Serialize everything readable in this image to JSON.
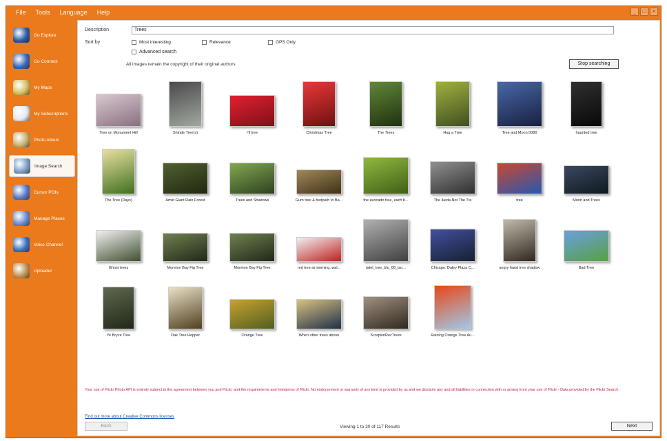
{
  "window": {
    "menu": [
      "File",
      "Tools",
      "Language",
      "Help"
    ],
    "buttons": [
      "_",
      "□",
      "×"
    ]
  },
  "sidebar": {
    "items": [
      {
        "label": "Go Explore",
        "icon": "globe-icon",
        "color": "#2a5aa8"
      },
      {
        "label": "Go Connect",
        "icon": "network-globe-icon",
        "color": "#3a68b8"
      },
      {
        "label": "My Maps",
        "icon": "map-icon",
        "color": "#d8c060"
      },
      {
        "label": "My Subscriptions",
        "icon": "envelope-icon",
        "color": "#e8e8f0"
      },
      {
        "label": "Photo Album",
        "icon": "photo-album-icon",
        "color": "#c8b070"
      },
      {
        "label": "Image Search",
        "icon": "image-search-icon",
        "color": "#7aa0c8",
        "active": true
      },
      {
        "label": "Cursor POIs",
        "icon": "poi-icon",
        "color": "#5a7ac8"
      },
      {
        "label": "Manage Places",
        "icon": "places-icon",
        "color": "#6a8ad0"
      },
      {
        "label": "Voice Channel",
        "icon": "voice-icon",
        "color": "#3a70c0"
      },
      {
        "label": "Uploader",
        "icon": "uploader-icon",
        "color": "#c09050"
      }
    ]
  },
  "search": {
    "description_label": "Description",
    "description_value": "Trees",
    "sort_label": "Sort by",
    "sort_options": [
      "Most interesting",
      "Relevance",
      "GPS Only"
    ],
    "advanced_label": "Advanced search",
    "copyright_note": "All images remain the copyright of their original authors",
    "stop_button": "Stop searching"
  },
  "results": [
    {
      "caption": "Tree on Monument Hill",
      "colors": [
        "#d8c8d0",
        "#8a7080"
      ],
      "w": 66,
      "h": 48
    },
    {
      "caption": "Shinde Tree(s)",
      "colors": [
        "#4a4a4a",
        "#a0a8a0"
      ],
      "w": 48,
      "h": 66
    },
    {
      "caption": "I'll tree",
      "colors": [
        "#e02030",
        "#801018"
      ],
      "w": 66,
      "h": 46
    },
    {
      "caption": "Christmas Tree",
      "colors": [
        "#e83838",
        "#701010"
      ],
      "w": 48,
      "h": 66
    },
    {
      "caption": "The Trees",
      "colors": [
        "#608838",
        "#203010"
      ],
      "w": 48,
      "h": 66
    },
    {
      "caption": "Hug a Tree",
      "colors": [
        "#a0b040",
        "#405020"
      ],
      "w": 50,
      "h": 66
    },
    {
      "caption": "Tree and Moon 0080",
      "colors": [
        "#4868a8",
        "#182040"
      ],
      "w": 66,
      "h": 66
    },
    {
      "caption": "haunted tree",
      "colors": [
        "#303030",
        "#080808"
      ],
      "w": 46,
      "h": 66
    },
    {
      "caption": "The Tree (Days)",
      "colors": [
        "#e8e0a0",
        "#407020"
      ],
      "w": 48,
      "h": 66
    },
    {
      "caption": "Amid Giant Rain Forest",
      "colors": [
        "#506030",
        "#202810"
      ],
      "w": 66,
      "h": 46
    },
    {
      "caption": "Trees and Shadows",
      "colors": [
        "#80a850",
        "#304020"
      ],
      "w": 66,
      "h": 46
    },
    {
      "caption": "Gum tree & footpath to Ba...",
      "colors": [
        "#a08858",
        "#403018"
      ],
      "w": 66,
      "h": 36
    },
    {
      "caption": "the avocado tree, each b...",
      "colors": [
        "#90b840",
        "#406018"
      ],
      "w": 66,
      "h": 54
    },
    {
      "caption": "The Ikeda Not The Tre",
      "colors": [
        "#909090",
        "#303030"
      ],
      "w": 66,
      "h": 48
    },
    {
      "caption": "tree",
      "colors": [
        "#c84830",
        "#2858b0"
      ],
      "w": 66,
      "h": 46
    },
    {
      "caption": "Moon and Trees",
      "colors": [
        "#3a4860",
        "#101820"
      ],
      "w": 66,
      "h": 42
    },
    {
      "caption": "Ghost trees",
      "colors": [
        "#f0f0f0",
        "#405030"
      ],
      "w": 66,
      "h": 46
    },
    {
      "caption": "Moreton Bay Fig Tree",
      "colors": [
        "#708050",
        "#202818"
      ],
      "w": 66,
      "h": 42
    },
    {
      "caption": "Moreton Bay Fig Tree",
      "colors": [
        "#708050",
        "#202818"
      ],
      "w": 66,
      "h": 42
    },
    {
      "caption": "red tree at morning, wal...",
      "colors": [
        "#f0f0f0",
        "#c02020"
      ],
      "w": 66,
      "h": 36
    },
    {
      "caption": "tatet_tree_blu_08_jan...",
      "colors": [
        "#b0b0b0",
        "#404040"
      ],
      "w": 66,
      "h": 62
    },
    {
      "caption": "Chicago: Daley Plaza C...",
      "colors": [
        "#4050a0",
        "#182030"
      ],
      "w": 66,
      "h": 48
    },
    {
      "caption": "angry hand tree shadow",
      "colors": [
        "#c0b8a8",
        "#302820"
      ],
      "w": 48,
      "h": 62
    },
    {
      "caption": "Bad Tree",
      "colors": [
        "#68a0e0",
        "#58a040"
      ],
      "w": 66,
      "h": 46
    },
    {
      "caption": "Ye Bryce Tree",
      "colors": [
        "#606850",
        "#202818"
      ],
      "w": 46,
      "h": 62
    },
    {
      "caption": "Oak Tree Hopper",
      "colors": [
        "#e8e0c8",
        "#504020"
      ],
      "w": 50,
      "h": 62
    },
    {
      "caption": "Orange Tree",
      "colors": [
        "#c8a030",
        "#506020"
      ],
      "w": 66,
      "h": 44
    },
    {
      "caption": "When other trees above",
      "colors": [
        "#d8c080",
        "#203048"
      ],
      "w": 66,
      "h": 44
    },
    {
      "caption": "ScorpionRecTrees",
      "colors": [
        "#a09080",
        "#302820"
      ],
      "w": 66,
      "h": 48
    },
    {
      "caption": "Raining Orange Tree Au...",
      "colors": [
        "#e84818",
        "#a0c8e8"
      ],
      "w": 54,
      "h": 64
    }
  ],
  "footer": {
    "disclaimer": "Your use of Flickr Photo API is entirely subject to the agreement between you and Flickr, and the requirements and limitations of Flickr. No endorsement or warranty of any kind is provided by us and we disclaim any and all liabilities in connection with or arising from your use of Flickr - Data provided by the Flickr Search.",
    "cc_link": "Find out more about Creative Commons licenses",
    "back_button": "Back",
    "viewing_text": "Viewing 1 to 30 of 117 Results",
    "next_button": "Next"
  }
}
